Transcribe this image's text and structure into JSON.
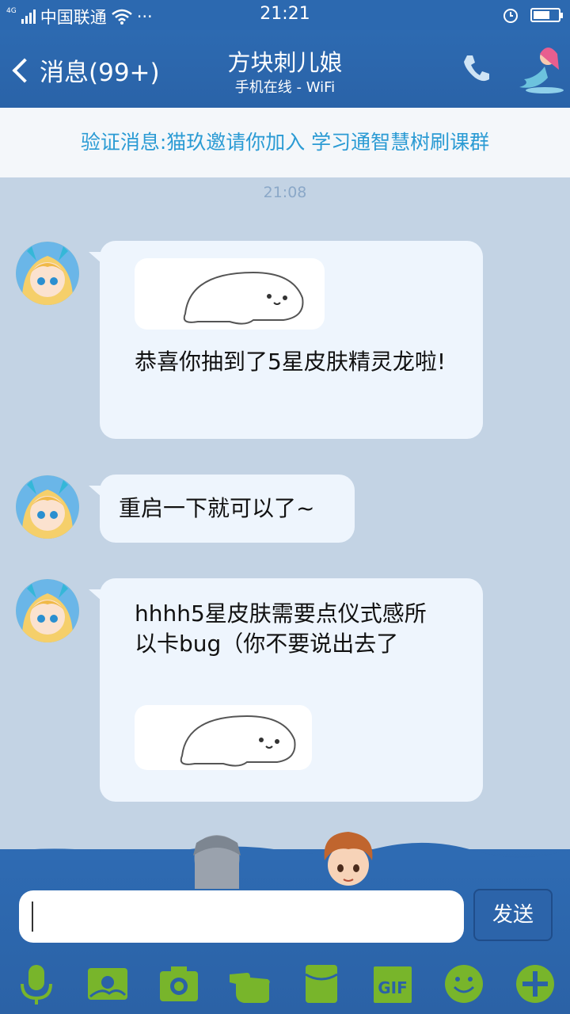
{
  "status_bar": {
    "network": "4G",
    "carrier": "中国联通",
    "more": "···",
    "time": "21:21"
  },
  "header": {
    "back_label": "消息(99+)",
    "title": "方块刺儿娘",
    "subtitle": "手机在线 - WiFi"
  },
  "notice": {
    "text": "验证消息:猫玖邀请你加入 学习通智慧树刷课群"
  },
  "chat": {
    "timestamp": "21:08",
    "messages": [
      {
        "text": "恭喜你抽到了5星皮肤精灵龙啦!"
      },
      {
        "text": "重启一下就可以了~"
      },
      {
        "text": "hhhh5星皮肤需要点仪式感所以卡bug（你不要说出去了"
      }
    ]
  },
  "input": {
    "placeholder": ""
  },
  "send_label": "发送",
  "toolbar_icons": [
    "mic-icon",
    "image-icon",
    "camera-icon",
    "hand-icon",
    "red-packet-icon",
    "gif-icon",
    "emoji-icon",
    "plus-icon"
  ],
  "colors": {
    "header_bg": "#2c69b0",
    "chat_bg": "#c3d3e4",
    "bubble_bg": "#eef5fd",
    "notice_text": "#2b9bd4",
    "tool_green": "#78b52b"
  }
}
